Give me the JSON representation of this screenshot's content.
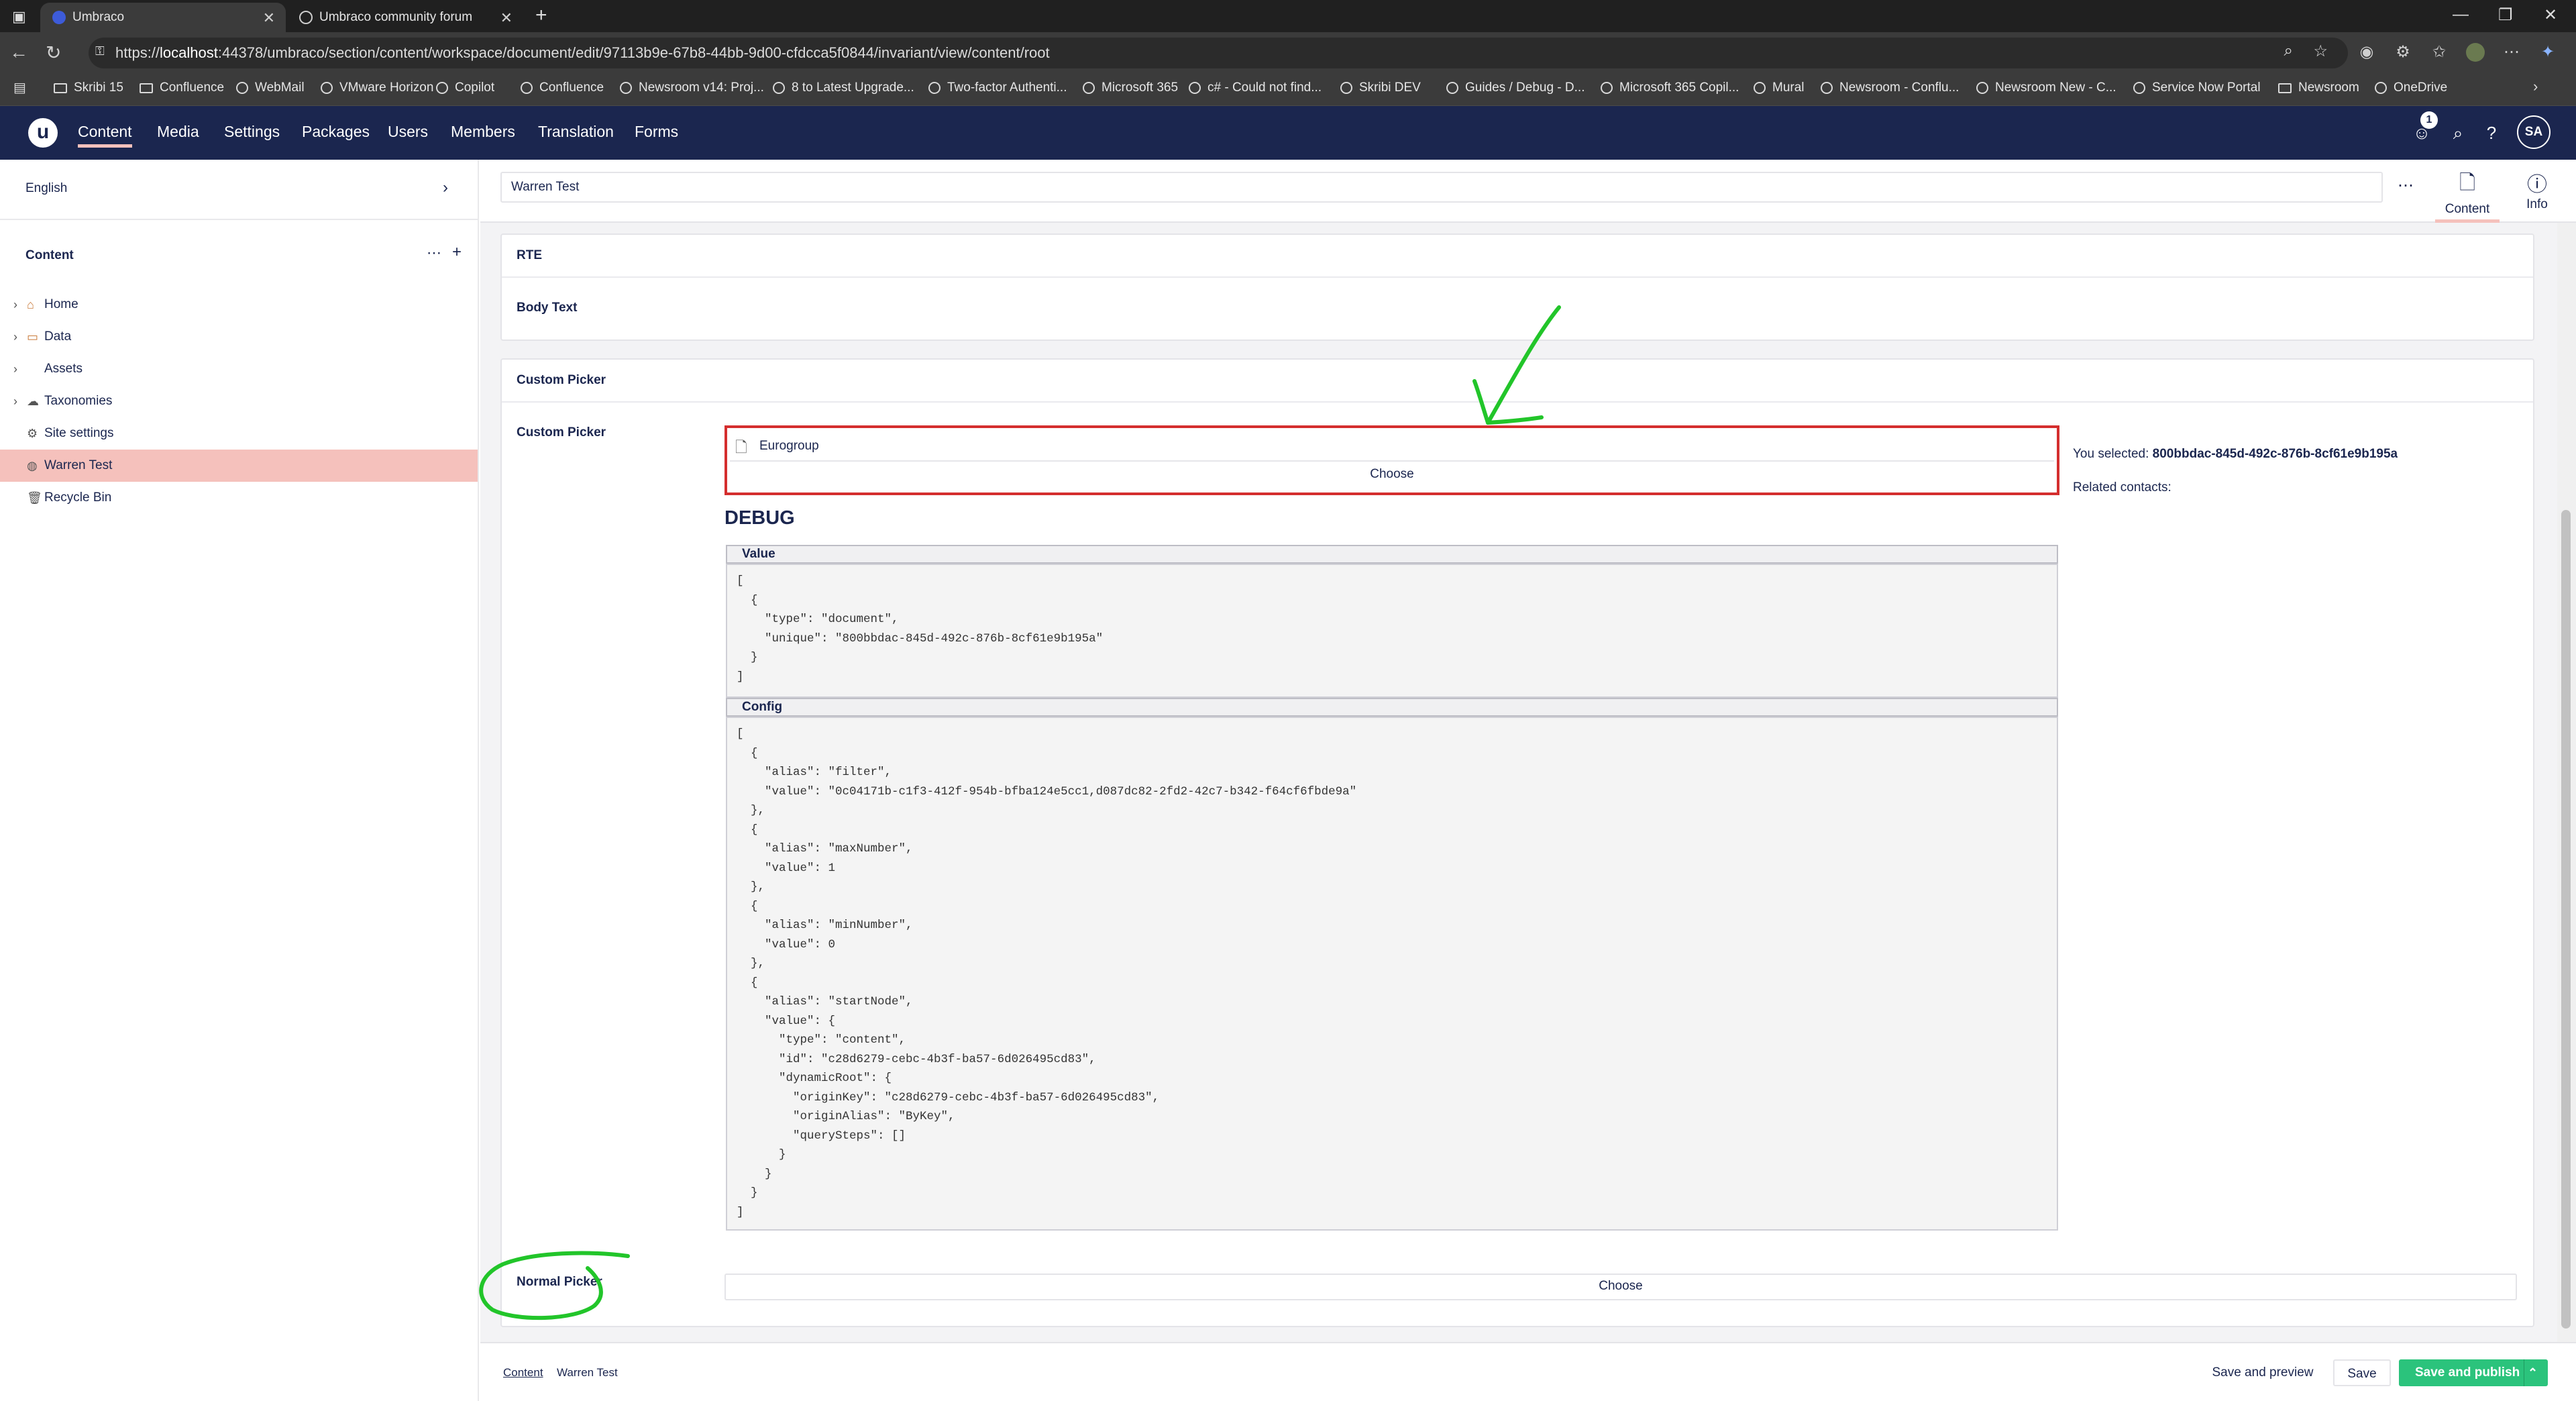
{
  "browser": {
    "tabs": [
      {
        "title": "Umbraco",
        "active": true
      },
      {
        "title": "Umbraco community forum",
        "active": false
      }
    ],
    "url_prefix": "https://",
    "url_host": "localhost",
    "url_rest": ":44378/umbraco/section/content/workspace/document/edit/97113b9e-67b8-44bb-9d00-cfdcca5f0844/invariant/view/content/root",
    "bookmarks": [
      {
        "label": "Skribi 15",
        "icon": "folder-icon"
      },
      {
        "label": "Confluence",
        "icon": "folder-icon"
      },
      {
        "label": "WebMail",
        "icon": "globe-icon"
      },
      {
        "label": "VMware Horizon",
        "icon": "globe-icon"
      },
      {
        "label": "Copilot",
        "icon": "globe-icon"
      },
      {
        "label": "Confluence",
        "icon": "globe-icon"
      },
      {
        "label": "Newsroom v14: Proj...",
        "icon": "globe-icon"
      },
      {
        "label": "8 to Latest Upgrade...",
        "icon": "globe-icon"
      },
      {
        "label": "Two-factor Authenti...",
        "icon": "globe-icon"
      },
      {
        "label": "Microsoft 365",
        "icon": "globe-icon"
      },
      {
        "label": "c# - Could not find...",
        "icon": "globe-icon"
      },
      {
        "label": "Skribi DEV",
        "icon": "globe-icon"
      },
      {
        "label": "Guides / Debug - D...",
        "icon": "globe-icon"
      },
      {
        "label": "Microsoft 365 Copil...",
        "icon": "globe-icon"
      },
      {
        "label": "Mural",
        "icon": "globe-icon"
      },
      {
        "label": "Newsroom - Conflu...",
        "icon": "globe-icon"
      },
      {
        "label": "Newsroom New - C...",
        "icon": "globe-icon"
      },
      {
        "label": "Service Now Portal",
        "icon": "globe-icon"
      },
      {
        "label": "Newsroom",
        "icon": "folder-icon"
      },
      {
        "label": "OneDrive",
        "icon": "globe-icon"
      }
    ]
  },
  "header": {
    "sections": [
      "Content",
      "Media",
      "Settings",
      "Packages",
      "Users",
      "Members",
      "Translation",
      "Forms"
    ],
    "active_section": "Content",
    "notification_count": "1",
    "avatar_initials": "SA"
  },
  "sidebar": {
    "language": "English",
    "tree_title": "Content",
    "items": [
      {
        "label": "Home",
        "icon": "home-icon",
        "expandable": true
      },
      {
        "label": "Data",
        "icon": "folder-icon",
        "expandable": true
      },
      {
        "label": "Assets",
        "icon": "",
        "expandable": true
      },
      {
        "label": "Taxonomies",
        "icon": "cloud-icon",
        "expandable": true
      },
      {
        "label": "Site settings",
        "icon": "gear-icon",
        "expandable": false
      },
      {
        "label": "Warren Test",
        "icon": "globe-icon",
        "expandable": false,
        "active": true
      },
      {
        "label": "Recycle Bin",
        "icon": "trash-icon",
        "expandable": false
      }
    ]
  },
  "document": {
    "name": "Warren Test",
    "apps": [
      {
        "label": "Content",
        "icon": "document-icon"
      },
      {
        "label": "Info",
        "icon": "info-icon"
      }
    ]
  },
  "groups": {
    "rte": {
      "title": "RTE",
      "property": "Body Text"
    },
    "custom": {
      "title": "Custom Picker",
      "property": "Custom Picker",
      "picked_item": "Eurogroup",
      "choose_label": "Choose",
      "selected_prefix": "You selected: ",
      "selected_value": "800bbdac-845d-492c-876b-8cf61e9b195a",
      "related_contacts": "Related contacts:",
      "debug_title": "DEBUG",
      "value_label": "Value",
      "value_code": "[\n  {\n    \"type\": \"document\",\n    \"unique\": \"800bbdac-845d-492c-876b-8cf61e9b195a\"\n  }\n]",
      "config_label": "Config",
      "config_code": "[\n  {\n    \"alias\": \"filter\",\n    \"value\": \"0c04171b-c1f3-412f-954b-bfba124e5cc1,d087dc82-2fd2-42c7-b342-f64cf6fbde9a\"\n  },\n  {\n    \"alias\": \"maxNumber\",\n    \"value\": 1\n  },\n  {\n    \"alias\": \"minNumber\",\n    \"value\": 0\n  },\n  {\n    \"alias\": \"startNode\",\n    \"value\": {\n      \"type\": \"content\",\n      \"id\": \"c28d6279-cebc-4b3f-ba57-6d026495cd83\",\n      \"dynamicRoot\": {\n        \"originKey\": \"c28d6279-cebc-4b3f-ba57-6d026495cd83\",\n        \"originAlias\": \"ByKey\",\n        \"querySteps\": []\n      }\n    }\n  }\n]"
    },
    "normal": {
      "property": "Normal Picker",
      "choose_label": "Choose"
    }
  },
  "footer": {
    "breadcrumb_root": "Content",
    "breadcrumb_current": "Warren Test",
    "save_preview": "Save and preview",
    "save": "Save",
    "save_publish": "Save and publish"
  },
  "colors": {
    "header_bg": "#1b264f",
    "accent_pink": "#f5c1bc",
    "publish_green": "#2bc37c",
    "picker_border_red": "#d42e2e",
    "annotation_green": "#22c52a"
  }
}
